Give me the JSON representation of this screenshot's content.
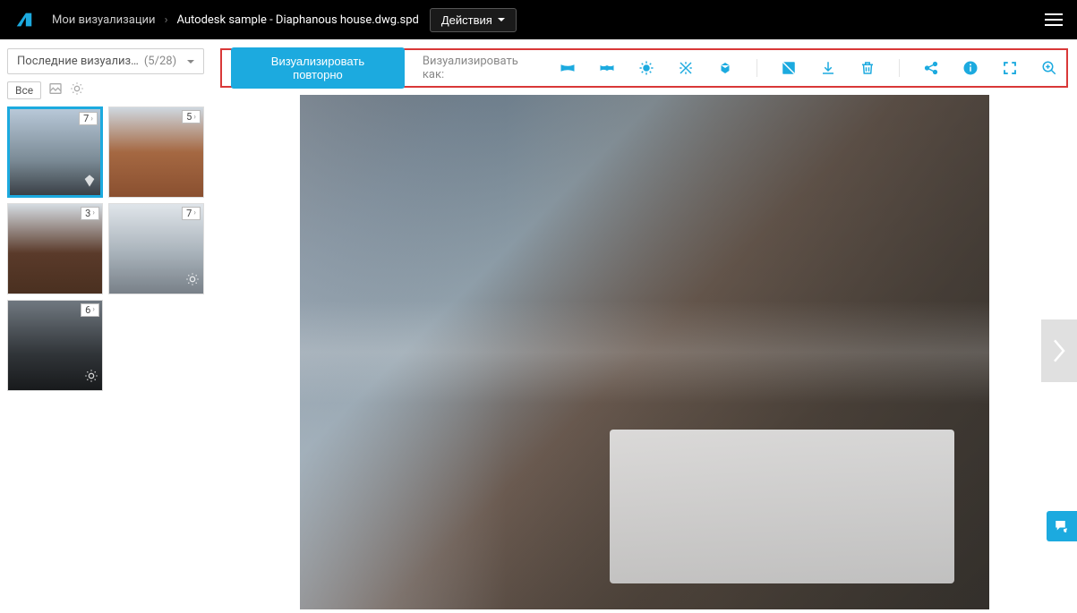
{
  "header": {
    "breadcrumb_root": "Мои визуализации",
    "breadcrumb_current": "Autodesk sample - Diaphanous house.dwg.spd",
    "actions_label": "Действия"
  },
  "sidebar": {
    "filter_label": "Последние визуализ…",
    "filter_count": "(5/28)",
    "filter_all": "Все",
    "thumbs": [
      {
        "badge": "7"
      },
      {
        "badge": "5"
      },
      {
        "badge": "3"
      },
      {
        "badge": "7"
      },
      {
        "badge": "6"
      }
    ]
  },
  "toolbar": {
    "rerender_label": "Визуализировать повторно",
    "render_as_label": "Визуализировать как:"
  }
}
